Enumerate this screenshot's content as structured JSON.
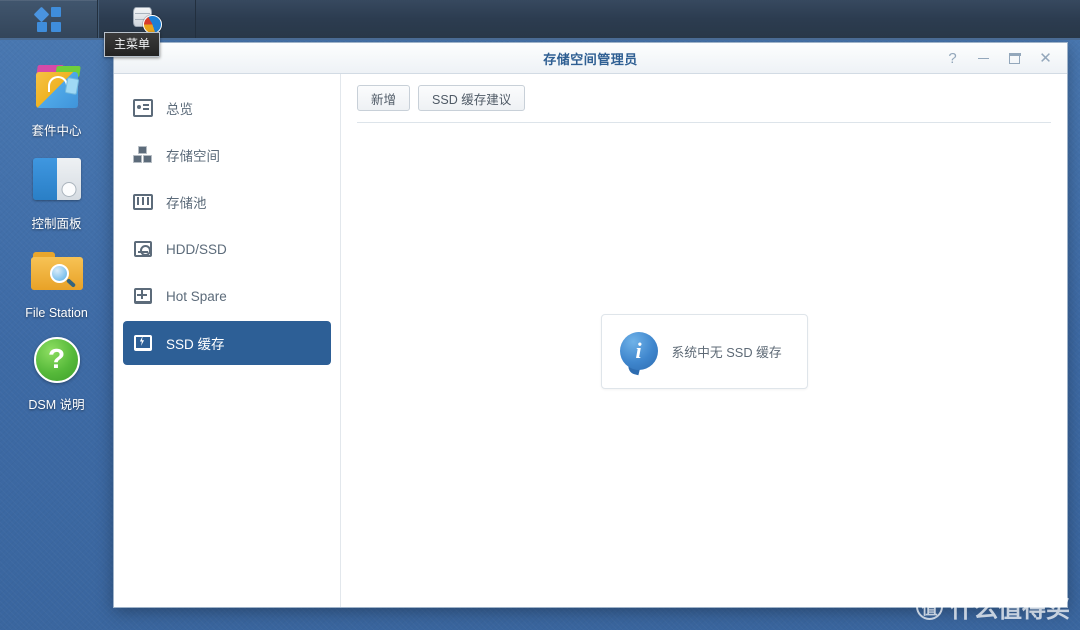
{
  "taskbar": {
    "main_menu_icon": "grid-menu-icon",
    "main_menu_tooltip": "主菜单",
    "app_icon": "storage-manager-icon"
  },
  "desktop": {
    "shortcuts": [
      {
        "label": "套件中心",
        "icon": "package-center-icon"
      },
      {
        "label": "控制面板",
        "icon": "control-panel-icon"
      },
      {
        "label": "File Station",
        "icon": "file-station-icon"
      },
      {
        "label": "DSM 说明",
        "icon": "help-icon"
      }
    ]
  },
  "window": {
    "title": "存储空间管理员",
    "controls": {
      "help": "?",
      "minimize": "–",
      "maximize": "□",
      "close": "✕"
    },
    "sidebar": {
      "items": [
        {
          "label": "总览",
          "icon": "overview-icon",
          "selected": false
        },
        {
          "label": "存储空间",
          "icon": "volume-icon",
          "selected": false
        },
        {
          "label": "存储池",
          "icon": "storage-pool-icon",
          "selected": false
        },
        {
          "label": "HDD/SSD",
          "icon": "disk-icon",
          "selected": false
        },
        {
          "label": "Hot Spare",
          "icon": "hot-spare-icon",
          "selected": false
        },
        {
          "label": "SSD 缓存",
          "icon": "ssd-cache-icon",
          "selected": true
        }
      ]
    },
    "toolbar": {
      "create_label": "新增",
      "advisor_label": "SSD 缓存建议"
    },
    "content": {
      "empty_message": "系统中无 SSD 缓存",
      "info_icon": "info-icon"
    }
  },
  "watermark": {
    "badge": "值",
    "text": "什么值得买"
  },
  "colors": {
    "desktop_blue": "#3f6fab",
    "taskbar_navy": "#2c3c50",
    "selected_nav": "#2d5f96",
    "title_blue": "#2f5f93",
    "info_blue": "#3f86cd"
  }
}
